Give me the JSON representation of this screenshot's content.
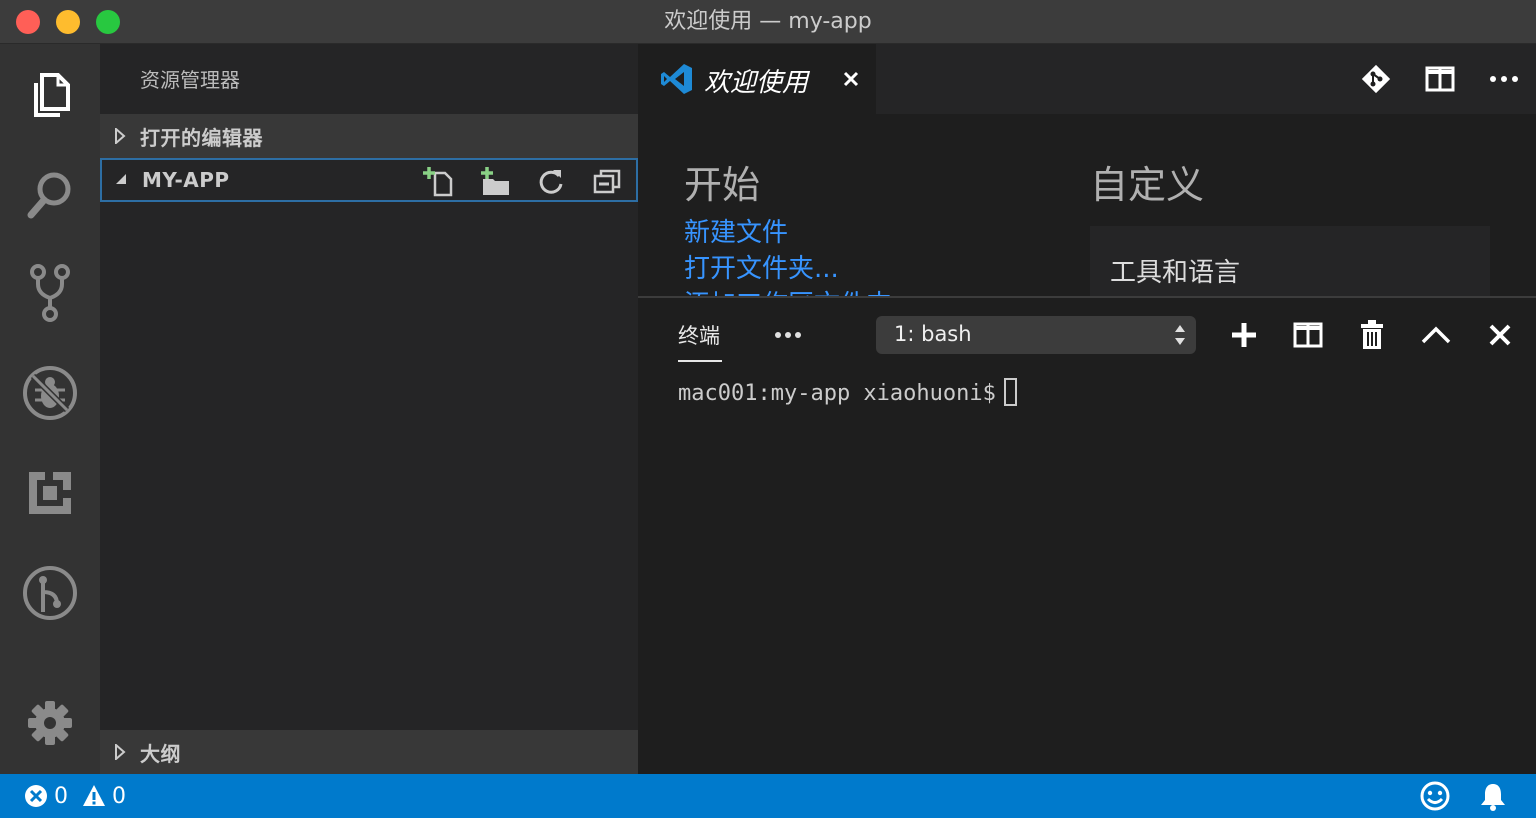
{
  "window": {
    "title": "欢迎使用 — my-app"
  },
  "activity_bar": {
    "items": [
      "explorer-icon",
      "search-icon",
      "source-control-icon",
      "debug-icon",
      "extensions-icon",
      "gitlens-icon"
    ],
    "manage": "gear-icon"
  },
  "sidebar": {
    "title": "资源管理器",
    "sections": {
      "open_editors": {
        "label": "打开的编辑器",
        "expanded": false
      },
      "folder": {
        "label": "MY-APP",
        "expanded": true
      },
      "outline": {
        "label": "大纲",
        "expanded": false
      }
    },
    "folder_actions": [
      "new-file-icon",
      "new-folder-icon",
      "refresh-icon",
      "collapse-all-icon"
    ]
  },
  "editor": {
    "tab": {
      "label": "欢迎使用",
      "icon": "vscode-icon"
    },
    "actions": [
      "git-compare-icon",
      "split-editor-icon",
      "more-icon"
    ],
    "welcome": {
      "start_heading": "开始",
      "start_links": [
        "新建文件",
        "打开文件夹...",
        "添加工作区文件夹..."
      ],
      "customize_heading": "自定义",
      "customize_box_title": "工具和语言"
    }
  },
  "panel": {
    "tab_label": "终端",
    "terminal_select": "1: bash",
    "actions": [
      "add-icon",
      "split-icon",
      "trash-icon",
      "maximize-icon",
      "close-icon"
    ],
    "prompt": "mac001:my-app xiaohuoni$"
  },
  "status_bar": {
    "errors": "0",
    "warnings": "0",
    "right_icons": [
      "smiley-icon",
      "bell-icon"
    ]
  },
  "colors": {
    "accent": "#007acc",
    "link": "#3794ff",
    "activity_bar": "#333333",
    "sidebar": "#252526",
    "editor": "#1e1e1e"
  }
}
